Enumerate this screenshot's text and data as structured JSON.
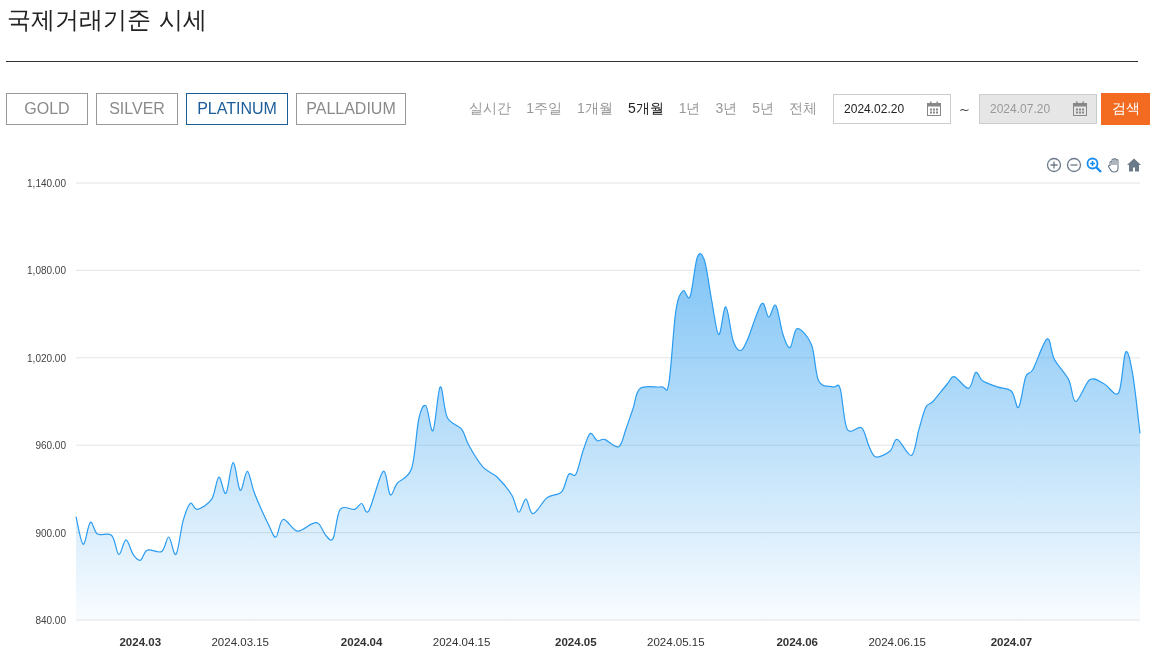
{
  "page_title": "국제거래기준 시세",
  "metals": [
    {
      "label": "GOLD",
      "selected": false
    },
    {
      "label": "SILVER",
      "selected": false
    },
    {
      "label": "PLATINUM",
      "selected": true
    },
    {
      "label": "PALLADIUM",
      "selected": false
    }
  ],
  "periods": [
    {
      "label": "실시간",
      "selected": false
    },
    {
      "label": "1주일",
      "selected": false
    },
    {
      "label": "1개월",
      "selected": false
    },
    {
      "label": "5개월",
      "selected": true
    },
    {
      "label": "1년",
      "selected": false
    },
    {
      "label": "3년",
      "selected": false
    },
    {
      "label": "5년",
      "selected": false
    },
    {
      "label": "전체",
      "selected": false
    }
  ],
  "date_from": {
    "value": "2024.02.20",
    "disabled": false
  },
  "range_separator": "~",
  "date_to": {
    "value": "2024.07.20",
    "disabled": true
  },
  "search_button": "검색",
  "chart_tools": [
    {
      "kind": "zoom-in",
      "selected": false
    },
    {
      "kind": "zoom-out",
      "selected": false
    },
    {
      "kind": "zoom-select",
      "selected": true
    },
    {
      "kind": "pan",
      "selected": false
    },
    {
      "kind": "home",
      "selected": false
    }
  ],
  "chart_data": {
    "type": "area",
    "grid": true,
    "xlim": [
      "2024-02-21",
      "2024-07-19"
    ],
    "ylim": [
      840,
      1140
    ],
    "yticks": [
      {
        "value": 840,
        "label": "840.00"
      },
      {
        "value": 900,
        "label": "900.00"
      },
      {
        "value": 960,
        "label": "960.00"
      },
      {
        "value": 1020,
        "label": "1,020.00"
      },
      {
        "value": 1080,
        "label": "1,080.00"
      },
      {
        "value": 1140,
        "label": "1,140.00"
      }
    ],
    "xticks": [
      {
        "value": "2024-03-01",
        "label": "2024.03"
      },
      {
        "value": "2024-03-15",
        "label": "2024.03.15"
      },
      {
        "value": "2024-04-01",
        "label": "2024.04"
      },
      {
        "value": "2024-04-15",
        "label": "2024.04.15"
      },
      {
        "value": "2024-05-01",
        "label": "2024.05"
      },
      {
        "value": "2024-05-15",
        "label": "2024.05.15"
      },
      {
        "value": "2024-06-01",
        "label": "2024.06"
      },
      {
        "value": "2024-06-15",
        "label": "2024.06.15"
      },
      {
        "value": "2024-07-01",
        "label": "2024.07"
      }
    ],
    "x": [
      "2024-02-21",
      "2024-02-22",
      "2024-02-23",
      "2024-02-24",
      "2024-02-26",
      "2024-02-27",
      "2024-02-28",
      "2024-02-29",
      "2024-03-01",
      "2024-03-02",
      "2024-03-04",
      "2024-03-05",
      "2024-03-06",
      "2024-03-07",
      "2024-03-08",
      "2024-03-09",
      "2024-03-11",
      "2024-03-12",
      "2024-03-13",
      "2024-03-14",
      "2024-03-15",
      "2024-03-16",
      "2024-03-17",
      "2024-03-19",
      "2024-03-20",
      "2024-03-21",
      "2024-03-23",
      "2024-03-25",
      "2024-03-26",
      "2024-03-27",
      "2024-03-28",
      "2024-03-29",
      "2024-03-31",
      "2024-04-01",
      "2024-04-02",
      "2024-04-04",
      "2024-04-05",
      "2024-04-06",
      "2024-04-08",
      "2024-04-09",
      "2024-04-10",
      "2024-04-11",
      "2024-04-12",
      "2024-04-13",
      "2024-04-15",
      "2024-04-16",
      "2024-04-18",
      "2024-04-20",
      "2024-04-22",
      "2024-04-23",
      "2024-04-24",
      "2024-04-25",
      "2024-04-27",
      "2024-04-29",
      "2024-04-30",
      "2024-05-01",
      "2024-05-02",
      "2024-05-03",
      "2024-05-04",
      "2024-05-05",
      "2024-05-07",
      "2024-05-08",
      "2024-05-09",
      "2024-05-10",
      "2024-05-13",
      "2024-05-14",
      "2024-05-15",
      "2024-05-16",
      "2024-05-17",
      "2024-05-18",
      "2024-05-19",
      "2024-05-20",
      "2024-05-21",
      "2024-05-22",
      "2024-05-23",
      "2024-05-24",
      "2024-05-25",
      "2024-05-27",
      "2024-05-28",
      "2024-05-29",
      "2024-05-30",
      "2024-05-31",
      "2024-06-01",
      "2024-06-03",
      "2024-06-04",
      "2024-06-06",
      "2024-06-07",
      "2024-06-08",
      "2024-06-10",
      "2024-06-11",
      "2024-06-12",
      "2024-06-14",
      "2024-06-15",
      "2024-06-17",
      "2024-06-18",
      "2024-06-19",
      "2024-06-20",
      "2024-06-22",
      "2024-06-23",
      "2024-06-25",
      "2024-06-26",
      "2024-06-27",
      "2024-06-29",
      "2024-07-01",
      "2024-07-02",
      "2024-07-03",
      "2024-07-04",
      "2024-07-06",
      "2024-07-07",
      "2024-07-09",
      "2024-07-10",
      "2024-07-12",
      "2024-07-14",
      "2024-07-16",
      "2024-07-17",
      "2024-07-18",
      "2024-07-19"
    ],
    "series": [
      {
        "color": "#2b9cf0",
        "values": [
          911,
          892,
          907,
          899,
          898,
          885,
          895,
          885,
          881,
          888,
          887,
          897,
          885,
          908,
          920,
          916,
          923,
          938,
          927,
          948,
          929,
          942,
          927,
          905,
          897,
          909,
          901,
          906,
          906,
          898,
          896,
          916,
          916,
          920,
          915,
          942,
          926,
          934,
          944,
          978,
          987,
          970,
          1000,
          979,
          971,
          960,
          945,
          938,
          926,
          914,
          923,
          913,
          924,
          928,
          940,
          940,
          956,
          968,
          963,
          964,
          959,
          971,
          985,
          999,
          1000,
          1002,
          1052,
          1066,
          1062,
          1089,
          1087,
          1060,
          1036,
          1055,
          1032,
          1025,
          1032,
          1057,
          1048,
          1056,
          1036,
          1027,
          1040,
          1029,
          1004,
          1000,
          999,
          971,
          972,
          960,
          952,
          956,
          964,
          953,
          970,
          986,
          990,
          1002,
          1007,
          999,
          1010,
          1004,
          1000,
          997,
          986,
          1007,
          1012,
          1033,
          1019,
          1005,
          990,
          1005,
          1002,
          996,
          1024,
          1008,
          968
        ]
      }
    ]
  }
}
